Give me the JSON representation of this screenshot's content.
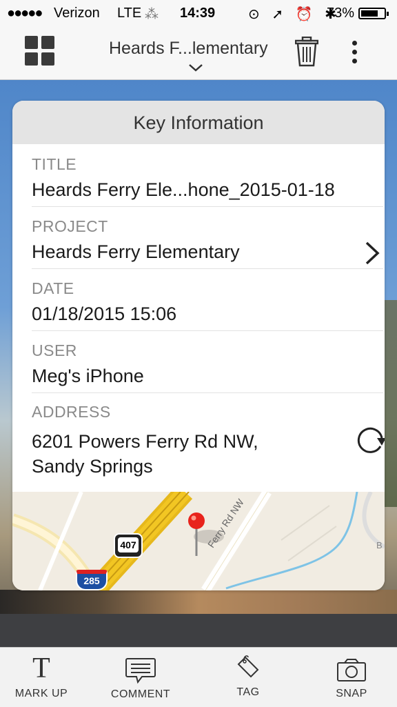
{
  "status_bar": {
    "signal": "●●●●●",
    "carrier": "Verizon",
    "network": "LTE",
    "activity": "⁂",
    "time": "14:39",
    "icons": "⊙ ➚ ⏰ ✱",
    "battery_percent": "73%",
    "battery_level": 0.73
  },
  "nav": {
    "title": "Heards F...lementary"
  },
  "card": {
    "header": "Key Information",
    "fields": [
      {
        "label": "TITLE",
        "value": "Heards Ferry Ele...hone_2015-01-18"
      },
      {
        "label": "PROJECT",
        "value": "Heards Ferry Elementary"
      },
      {
        "label": "DATE",
        "value": "01/18/2015 15:06"
      },
      {
        "label": "USER",
        "value": "Meg's iPhone"
      },
      {
        "label": "ADDRESS",
        "value_line1": "6201 Powers Ferry Rd NW,",
        "value_line2": "Sandy Springs"
      }
    ]
  },
  "map": {
    "route_shield": "407",
    "interstate_shield": "285",
    "road_label": "Ferry Rd NW",
    "edge_label": "B"
  },
  "tabs": [
    {
      "label": "MARK UP",
      "icon": "T"
    },
    {
      "label": "COMMENT",
      "icon": "comment-icon"
    },
    {
      "label": "TAG",
      "icon": "tag-icon"
    },
    {
      "label": "SNAP",
      "icon": "camera-icon"
    }
  ],
  "colors": {
    "pin": "#e8231c",
    "highway": "#f2c623",
    "water": "#7ec3e6"
  }
}
